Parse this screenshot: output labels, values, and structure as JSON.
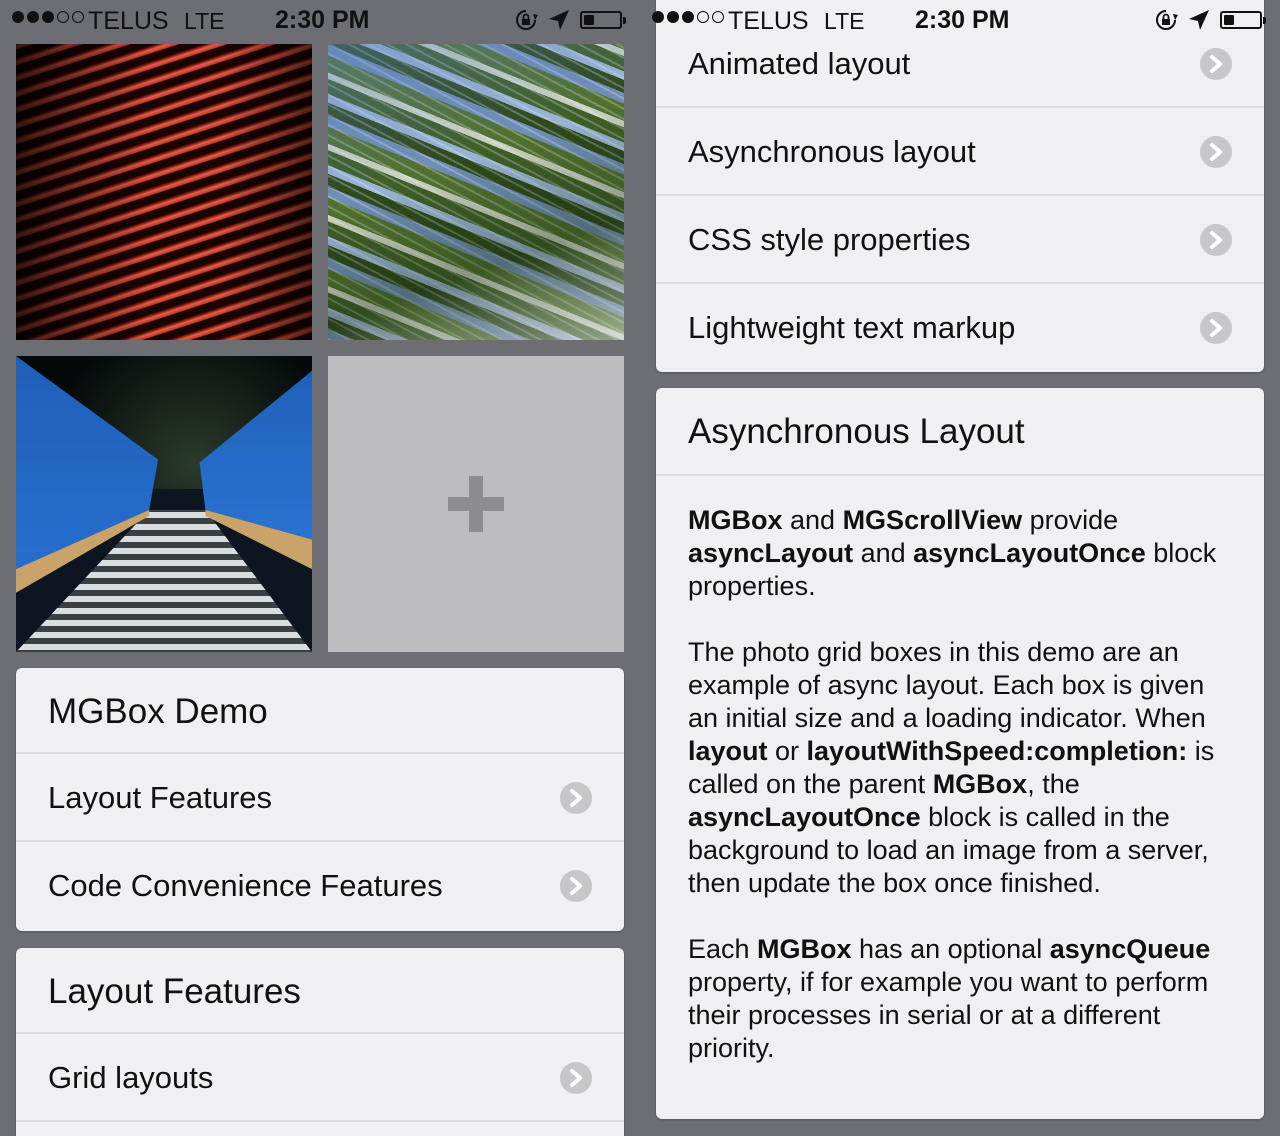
{
  "status_bar": {
    "carrier": "TELUS",
    "network": "LTE",
    "time": "2:30 PM",
    "signal_bars": 3,
    "signal_total": 5,
    "battery_level": 0.3,
    "icons": [
      "orientation-lock-icon",
      "location-arrow-icon",
      "battery-icon"
    ]
  },
  "left_screen": {
    "photo_grid": {
      "photos": [
        "red-stripes-photo",
        "blurred-trees-photo",
        "blue-bridge-photo"
      ],
      "add_tile_icon": "plus-icon"
    },
    "demo_card": {
      "title": "MGBox Demo",
      "items": [
        {
          "label": "Layout Features"
        },
        {
          "label": "Code Convenience Features"
        }
      ]
    },
    "layout_card": {
      "title": "Layout Features",
      "items": [
        {
          "label": "Grid layouts"
        }
      ]
    }
  },
  "right_screen": {
    "features_card": {
      "items": [
        {
          "label": "Animated layout"
        },
        {
          "label": "Asynchronous layout"
        },
        {
          "label": "CSS style properties"
        },
        {
          "label": "Lightweight text markup"
        }
      ]
    },
    "async_card": {
      "title": "Asynchronous Layout",
      "p1": [
        {
          "t": "MGBox",
          "b": true
        },
        {
          "t": " and ",
          "b": false
        },
        {
          "t": "MGScrollView",
          "b": true
        },
        {
          "t": " provide ",
          "b": false
        },
        {
          "t": "asyncLayout",
          "b": true
        },
        {
          "t": " and ",
          "b": false
        },
        {
          "t": "asyncLayoutOnce",
          "b": true
        },
        {
          "t": " block properties.",
          "b": false
        }
      ],
      "p2": [
        {
          "t": "The photo grid boxes in this demo are an example of async layout. Each box is given an initial size and a loading indicator. When ",
          "b": false
        },
        {
          "t": "layout",
          "b": true
        },
        {
          "t": " or ",
          "b": false
        },
        {
          "t": "layoutWithSpeed:completion:",
          "b": true
        },
        {
          "t": " is called on the parent ",
          "b": false
        },
        {
          "t": "MGBox",
          "b": true
        },
        {
          "t": ", the ",
          "b": false
        },
        {
          "t": "asyncLayoutOnce",
          "b": true
        },
        {
          "t": " block is called in the background to load an image from a server, then update the box once finished.",
          "b": false
        }
      ],
      "p3": [
        {
          "t": "Each ",
          "b": false
        },
        {
          "t": "MGBox",
          "b": true
        },
        {
          "t": " has an optional ",
          "b": false
        },
        {
          "t": "asyncQueue",
          "b": true
        },
        {
          "t": " property, if for example you want to perform their processes in serial or at a different priority.",
          "b": false
        }
      ]
    }
  }
}
